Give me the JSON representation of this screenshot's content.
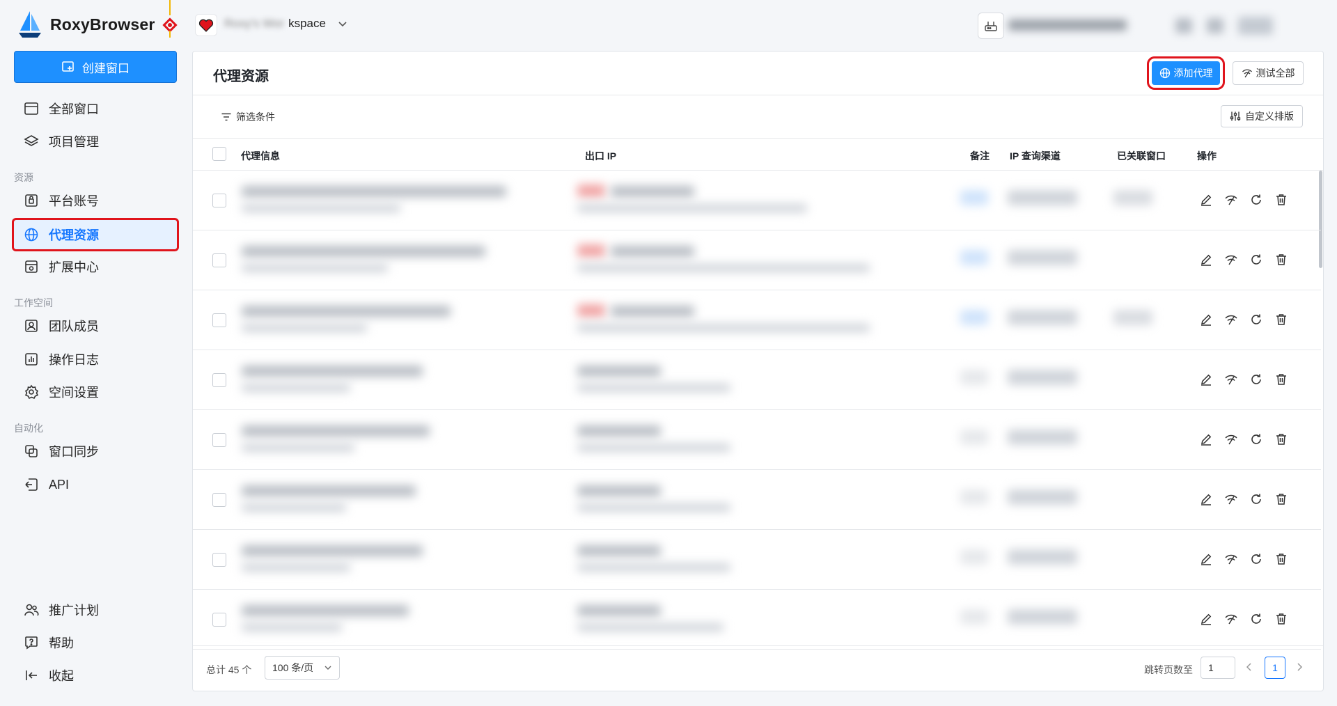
{
  "brand": {
    "name": "RoxyBrowser"
  },
  "workspace": {
    "name_suffix": "kspace",
    "name_blurred": "Roxy's Wor"
  },
  "sidebar": {
    "create_button": "创建窗口",
    "items_top": [
      {
        "label": "全部窗口",
        "icon": "window-icon"
      },
      {
        "label": "项目管理",
        "icon": "layers-icon"
      }
    ],
    "section_resources": "资源",
    "items_resources": [
      {
        "label": "平台账号",
        "icon": "account-icon"
      },
      {
        "label": "代理资源",
        "icon": "globe-icon",
        "active": true
      },
      {
        "label": "扩展中心",
        "icon": "extension-icon"
      }
    ],
    "section_workspace": "工作空间",
    "items_workspace": [
      {
        "label": "团队成员",
        "icon": "member-icon"
      },
      {
        "label": "操作日志",
        "icon": "log-icon"
      },
      {
        "label": "空间设置",
        "icon": "gear-icon"
      }
    ],
    "section_automation": "自动化",
    "items_automation": [
      {
        "label": "窗口同步",
        "icon": "sync-icon"
      },
      {
        "label": "API",
        "icon": "api-icon"
      }
    ],
    "items_bottom": [
      {
        "label": "推广计划",
        "icon": "users-icon"
      },
      {
        "label": "帮助",
        "icon": "help-icon"
      },
      {
        "label": "收起",
        "icon": "collapse-icon"
      }
    ]
  },
  "panel": {
    "title": "代理资源",
    "add_button": "添加代理",
    "test_all_button": "测试全部",
    "filter_button": "筛选条件",
    "custom_sort_button": "自定义排版"
  },
  "table": {
    "columns": [
      "代理信息",
      "出口 IP",
      "备注",
      "IP 查询渠道",
      "已关联窗口",
      "操作"
    ],
    "row_count": 8
  },
  "footer": {
    "total": "总计 45 个",
    "page_size": "100 条/页",
    "jump_label": "跳转页数至",
    "jump_value": "1",
    "current_page": "1"
  },
  "colors": {
    "accent": "#1e90ff",
    "highlight": "#e0141c",
    "active_bg": "#e6f1ff"
  }
}
